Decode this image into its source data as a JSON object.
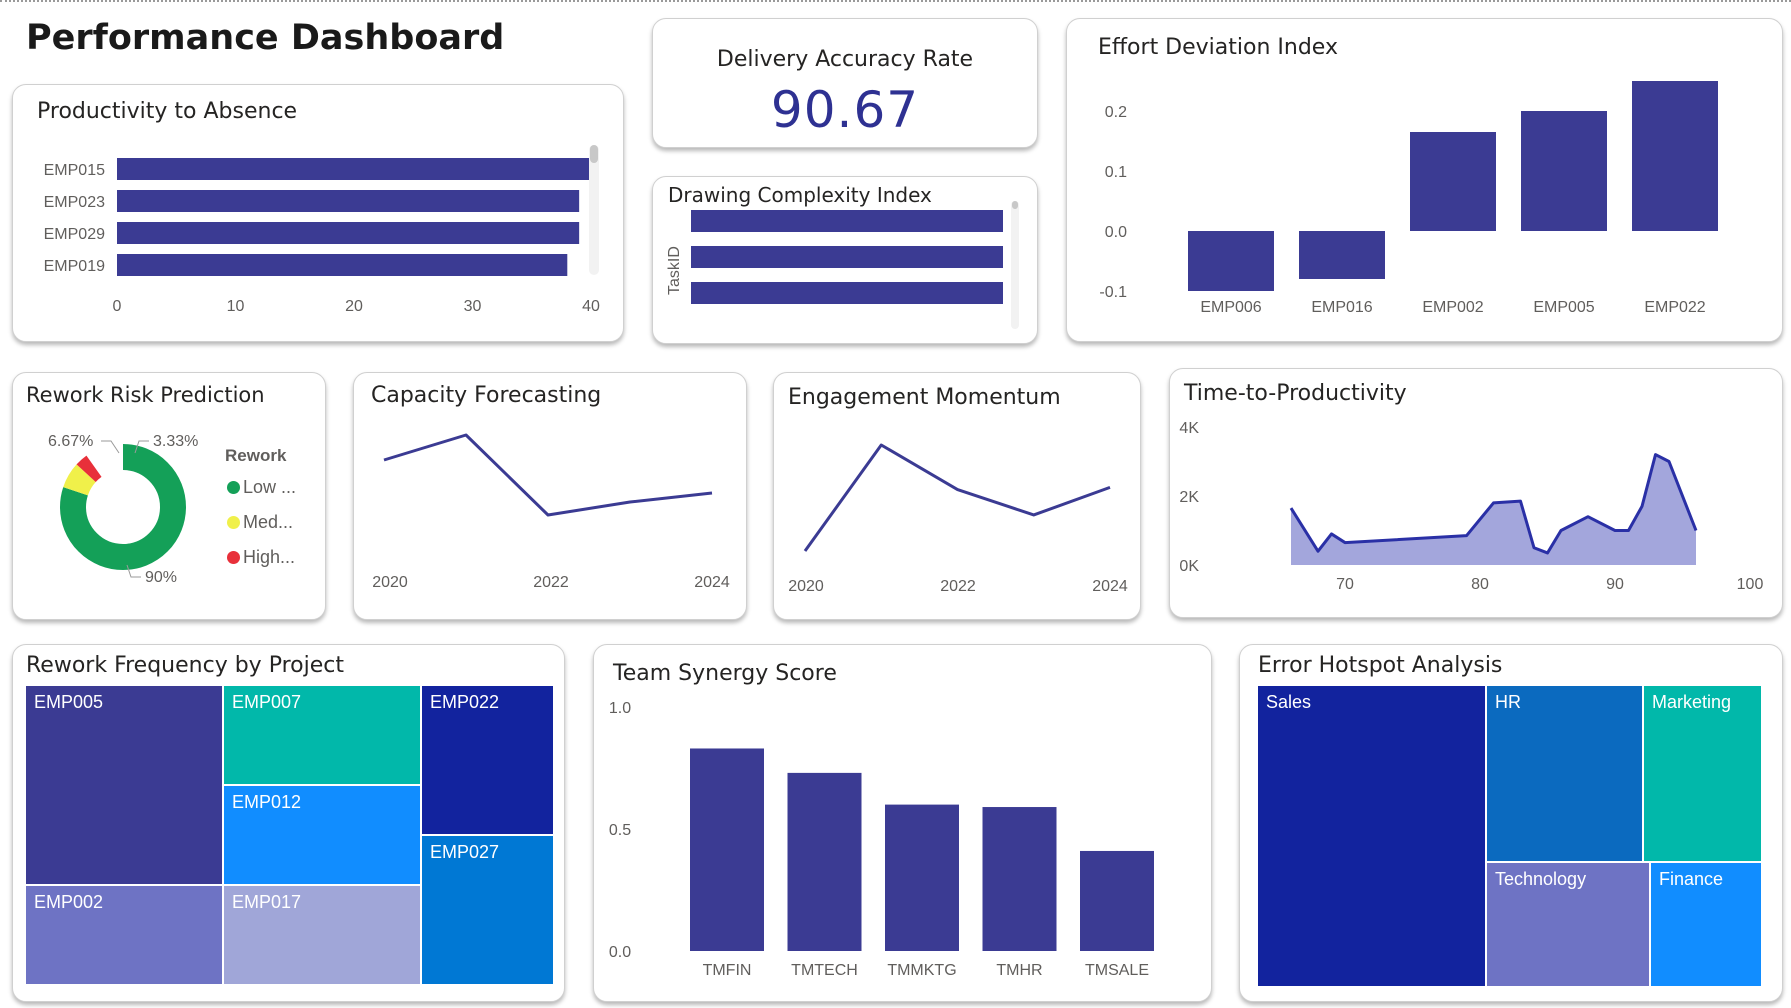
{
  "page": {
    "title": "Performance Dashboard"
  },
  "colors": {
    "bar": "#3b3b93",
    "line": "#3b3b93",
    "area_line": "#2a30a6",
    "area_fill": "#a3a6dc",
    "donut_low": "#14a058",
    "donut_medium": "#f0f04a",
    "donut_high": "#e8303a"
  },
  "kpi": {
    "label": "Delivery Accuracy Rate",
    "value": "90.67"
  },
  "charts": {
    "productivity": {
      "title": "Productivity to Absence",
      "chart_data": {
        "type": "bar",
        "orientation": "horizontal",
        "categories": [
          "EMP015",
          "EMP023",
          "EMP029",
          "EMP019"
        ],
        "values": [
          40,
          39,
          39,
          38
        ],
        "xlim": [
          0,
          40
        ],
        "xticks": [
          "0",
          "10",
          "20",
          "30",
          "40"
        ]
      }
    },
    "drawing": {
      "title": "Drawing Complexity Index",
      "chart_data": {
        "type": "bar",
        "orientation": "horizontal",
        "ylabel": "TaskID",
        "values": [
          1,
          1,
          1
        ]
      }
    },
    "effort": {
      "title": "Effort Deviation Index",
      "chart_data": {
        "type": "bar",
        "categories": [
          "EMP006",
          "EMP016",
          "EMP002",
          "EMP005",
          "EMP022"
        ],
        "values": [
          -0.1,
          -0.08,
          0.165,
          0.2,
          0.25
        ],
        "ylim": [
          -0.1,
          0.25
        ],
        "yticks": [
          "0.2",
          "0.1",
          "0.0",
          "-0.1"
        ]
      }
    },
    "rework_risk": {
      "title": "Rework Risk Prediction",
      "legend_title": "Rework",
      "chart_data": {
        "type": "pie",
        "variant": "donut",
        "labels": [
          "Low ...",
          "Med...",
          "High..."
        ],
        "values": [
          90,
          6.67,
          3.33
        ],
        "data_labels": [
          "90%",
          "6.67%",
          "3.33%"
        ]
      }
    },
    "capacity": {
      "title": "Capacity Forecasting",
      "chart_data": {
        "type": "line",
        "x": [
          2020,
          2021,
          2022,
          2023,
          2024
        ],
        "values": [
          0.75,
          1.0,
          0.2,
          0.33,
          0.42
        ],
        "xticks": [
          "2020",
          "2022",
          "2024"
        ]
      }
    },
    "engagement": {
      "title": "Engagement Momentum",
      "chart_data": {
        "type": "line",
        "x": [
          2020,
          2021,
          2022,
          2023,
          2024
        ],
        "values": [
          0.0,
          1.0,
          0.58,
          0.34,
          0.6
        ],
        "xticks": [
          "2020",
          "2022",
          "2024"
        ]
      }
    },
    "time_to_prod": {
      "title": "Time-to-Productivity",
      "chart_data": {
        "type": "area",
        "x": [
          66,
          68,
          69,
          70,
          79,
          81,
          83,
          84,
          85,
          86,
          88,
          90,
          91,
          92,
          93,
          94,
          96
        ],
        "values": [
          1650,
          400,
          900,
          650,
          850,
          1800,
          1850,
          500,
          350,
          1000,
          1400,
          1000,
          1000,
          1700,
          3200,
          3000,
          1000
        ],
        "xlim": [
          62,
          100
        ],
        "ylim": [
          0,
          4000
        ],
        "xticks": [
          "70",
          "80",
          "90",
          "100"
        ],
        "yticks": [
          "4K",
          "2K",
          "0K"
        ]
      }
    },
    "rework_freq": {
      "title": "Rework Frequency by Project",
      "chart_data": {
        "type": "treemap",
        "labels": [
          "EMP005",
          "EMP002",
          "EMP007",
          "EMP012",
          "EMP017",
          "EMP022",
          "EMP027"
        ],
        "colors": [
          "#3b3b93",
          "#6e73c4",
          "#01b8aa",
          "#118dff",
          "#a0a6d8",
          "#12239e",
          "#0078d4"
        ]
      }
    },
    "synergy": {
      "title": "Team Synergy Score",
      "chart_data": {
        "type": "bar",
        "categories": [
          "TMFIN",
          "TMTECH",
          "TMMKTG",
          "TMHR",
          "TMSALE"
        ],
        "values": [
          0.83,
          0.73,
          0.6,
          0.59,
          0.41
        ],
        "ylim": [
          0,
          1.0
        ],
        "yticks": [
          "1.0",
          "0.5",
          "0.0"
        ]
      }
    },
    "error_hotspot": {
      "title": "Error Hotspot Analysis",
      "chart_data": {
        "type": "treemap",
        "labels": [
          "Sales",
          "HR",
          "Marketing",
          "Technology",
          "Finance"
        ],
        "colors": [
          "#12239e",
          "#0b6abf",
          "#01b8aa",
          "#6e73c4",
          "#118dff"
        ]
      }
    }
  }
}
